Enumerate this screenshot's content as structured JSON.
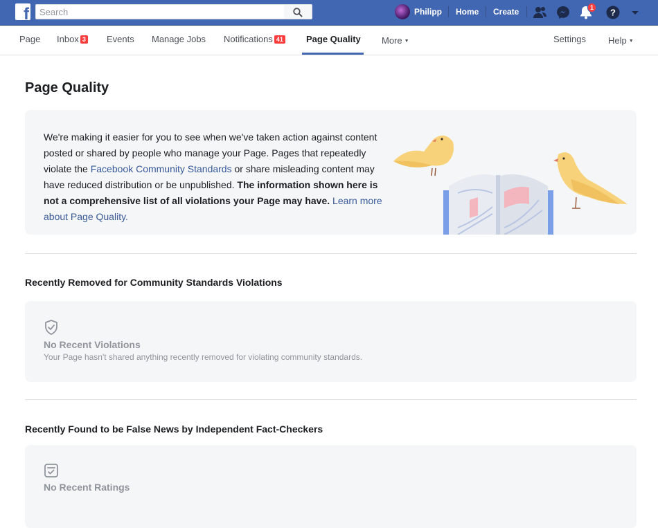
{
  "topbar": {
    "logo": "f",
    "search_placeholder": "Search",
    "profile_name": "Philipp",
    "home_label": "Home",
    "create_label": "Create",
    "notifications_count": "1",
    "icons": [
      "friends-icon",
      "messenger-icon",
      "notifications-icon",
      "help-icon",
      "account-menu-icon"
    ],
    "brand_color": "#4267b2"
  },
  "subnav": {
    "tabs": [
      {
        "label": "Page"
      },
      {
        "label": "Inbox",
        "badge": "3"
      },
      {
        "label": "Events"
      },
      {
        "label": "Manage Jobs"
      },
      {
        "label": "Notifications",
        "badge": "41"
      },
      {
        "label": "Page Quality",
        "active": true
      },
      {
        "label": "More"
      }
    ],
    "settings_label": "Settings",
    "help_label": "Help"
  },
  "main": {
    "title": "Page Quality",
    "intro": {
      "text_1": "We're making it easier for you to see when we've taken action against content posted or shared by people who manage your Page. Pages that repeatedly violate the ",
      "link_standards": "Facebook Community Standards",
      "text_2": " or share misleading content may have reduced distribution or be unpublished. ",
      "bold_text": "The information shown here is not a comprehensive list of all violations your Page may have.",
      "link_learn": "Learn more about Page Quality."
    },
    "sections": [
      {
        "title": "Recently Removed for Community Standards Violations",
        "status_head": "No Recent Violations",
        "status_desc": "Your Page hasn't shared anything recently removed for violating community standards.",
        "icon": "shield-check-icon"
      },
      {
        "title": "Recently Found to be False News by Independent Fact-Checkers",
        "status_head": "No Recent Ratings",
        "icon": "checklist-icon"
      }
    ]
  }
}
